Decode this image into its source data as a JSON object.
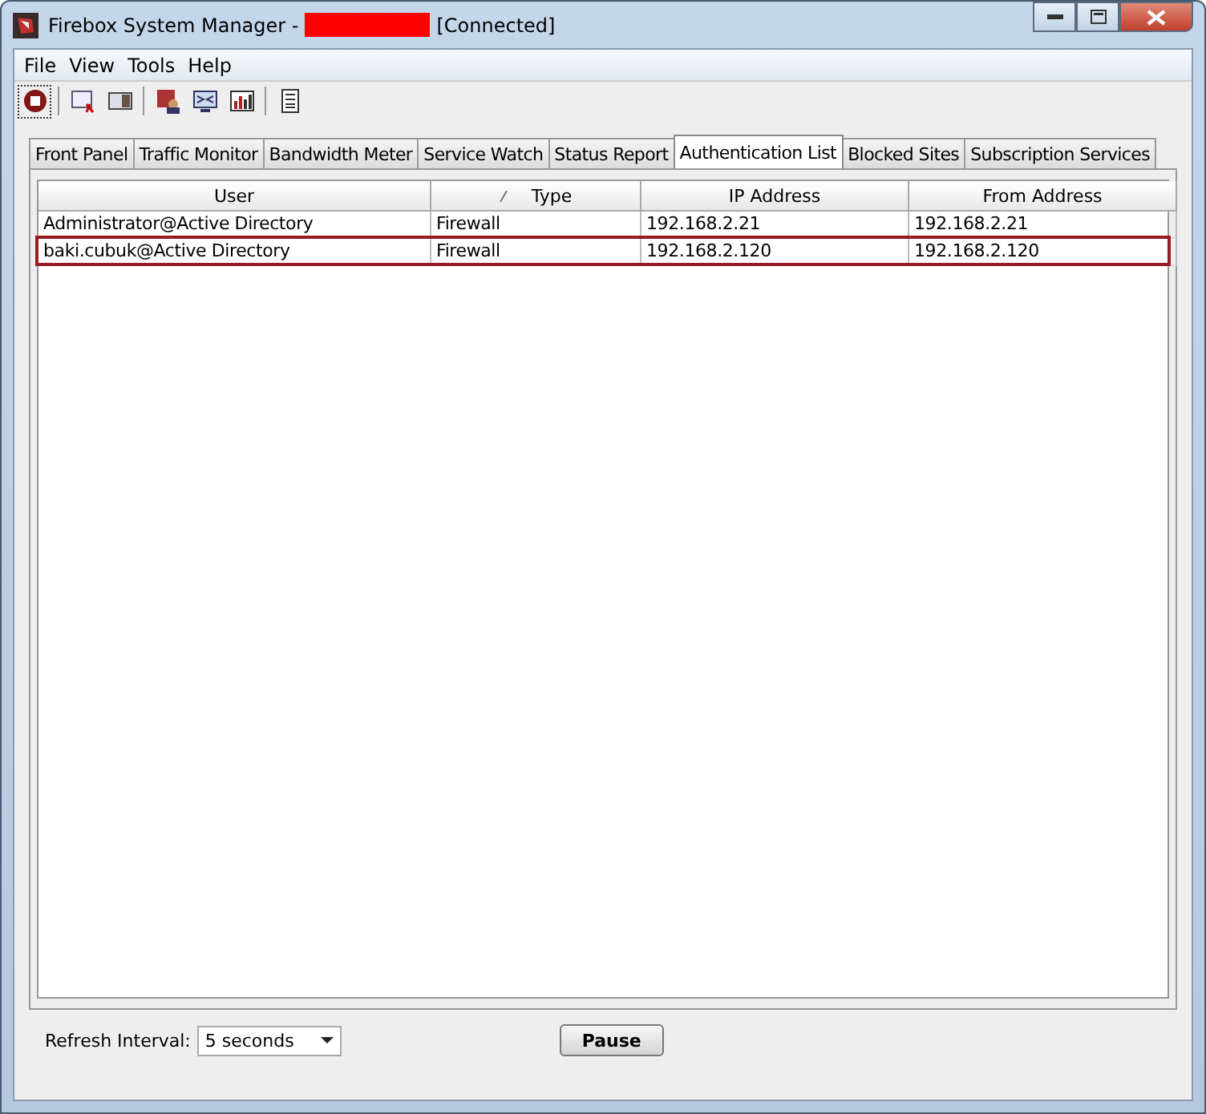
{
  "window": {
    "title": "Firebox System Manager -",
    "title_status": "[Connected]"
  },
  "menu": [
    "File",
    "View",
    "Tools",
    "Help"
  ],
  "tabs": [
    {
      "label": "Front Panel",
      "selected": false
    },
    {
      "label": "Traffic Monitor",
      "selected": false
    },
    {
      "label": "Bandwidth Meter",
      "selected": false
    },
    {
      "label": "Service Watch",
      "selected": false
    },
    {
      "label": "Status Report",
      "selected": false
    },
    {
      "label": "Authentication List",
      "selected": true
    },
    {
      "label": "Blocked Sites",
      "selected": false
    },
    {
      "label": "Subscription Services",
      "selected": false
    }
  ],
  "table": {
    "columns": [
      {
        "label": "User",
        "sorted": false
      },
      {
        "label": "Type",
        "sorted": true
      },
      {
        "label": "IP Address",
        "sorted": false
      },
      {
        "label": "From Address",
        "sorted": false
      }
    ],
    "rows": [
      {
        "cells": [
          "Administrator@Active Directory",
          "Firewall",
          "192.168.2.21",
          "192.168.2.21"
        ],
        "highlighted": false
      },
      {
        "cells": [
          "baki.cubuk@Active Directory",
          "Firewall",
          "192.168.2.120",
          "192.168.2.120"
        ],
        "highlighted": true
      }
    ]
  },
  "refresh": {
    "label": "Refresh Interval:",
    "value": "5 seconds"
  },
  "pause_button": "Pause"
}
